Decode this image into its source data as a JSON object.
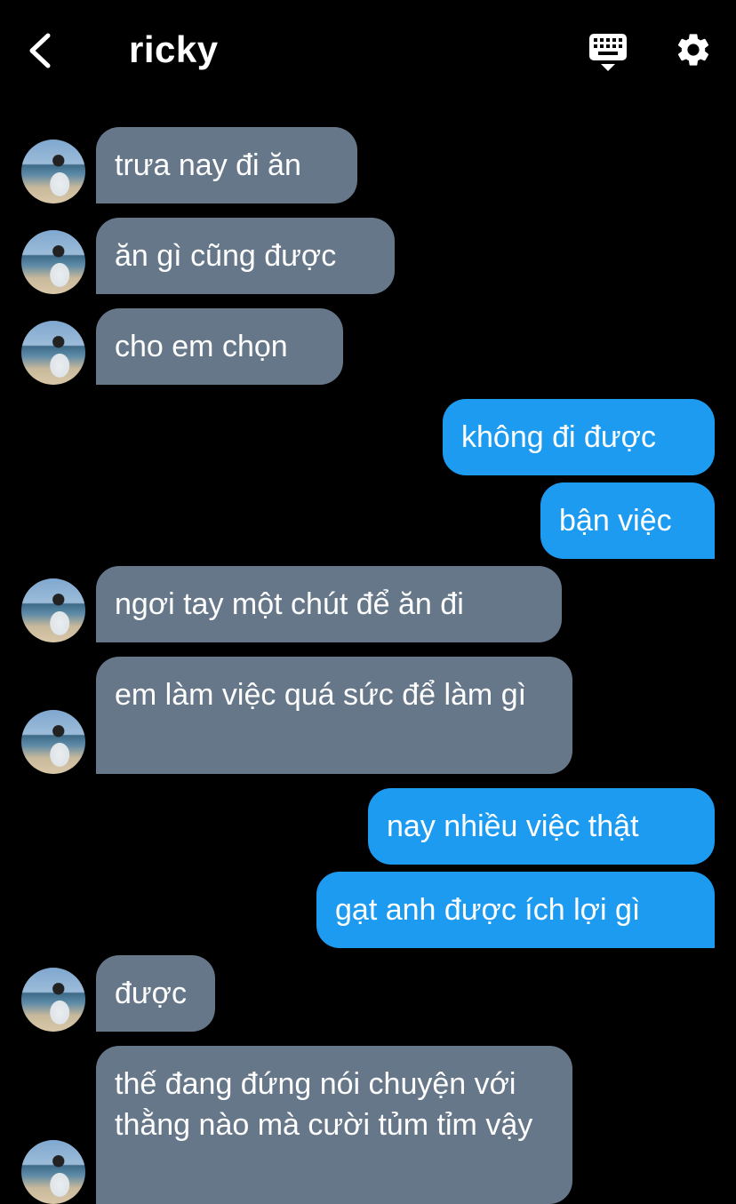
{
  "header": {
    "title": "ricky",
    "back_icon": "chevron-left-icon",
    "keyboard_icon": "keyboard-icon",
    "settings_icon": "gear-icon"
  },
  "colors": {
    "incoming_bubble": "#66778a",
    "outgoing_bubble": "#1d9bf0",
    "background": "#000000"
  },
  "messages": [
    {
      "direction": "in",
      "text": "trưa nay đi ăn"
    },
    {
      "direction": "in",
      "text": "ăn gì cũng được"
    },
    {
      "direction": "in",
      "text": "cho em chọn"
    },
    {
      "direction": "out",
      "text": "không đi được"
    },
    {
      "direction": "out",
      "text": "bận việc"
    },
    {
      "direction": "in",
      "text": "ngơi tay một chút để ăn đi"
    },
    {
      "direction": "in",
      "text": "em làm việc quá sức để làm gì"
    },
    {
      "direction": "out",
      "text": "nay nhiều việc thật"
    },
    {
      "direction": "out",
      "text": "gạt anh được ích lợi gì"
    },
    {
      "direction": "in",
      "text": "được"
    },
    {
      "direction": "in",
      "text": "thế đang đứng nói chuyện với thằng nào mà cười tủm tỉm vậy"
    }
  ]
}
